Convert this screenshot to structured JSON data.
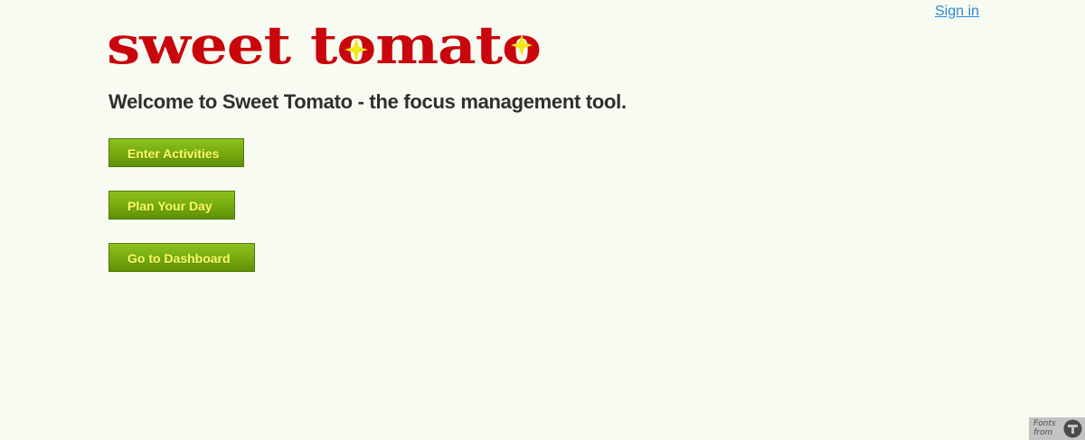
{
  "header": {
    "signin_label": "Sign in"
  },
  "logo": {
    "text": "sweet tomato",
    "color": "#c8060c",
    "star_color": "#f2e81a"
  },
  "main": {
    "welcome_text": "Welcome to Sweet Tomato - the focus management tool.",
    "buttons": [
      {
        "label": "Enter Activities"
      },
      {
        "label": "Plan Your Day"
      },
      {
        "label": "Go to Dashboard"
      }
    ]
  },
  "footer_badge": {
    "line1": "Fonts",
    "line2": "from",
    "icon": "fonts-provider-logo-icon"
  },
  "colors": {
    "background": "#f8fbf2",
    "button_green": "#75a90e",
    "button_text": "#fbf96a",
    "link_blue": "#2a8ad4",
    "heading_text": "#2e2f2e"
  }
}
